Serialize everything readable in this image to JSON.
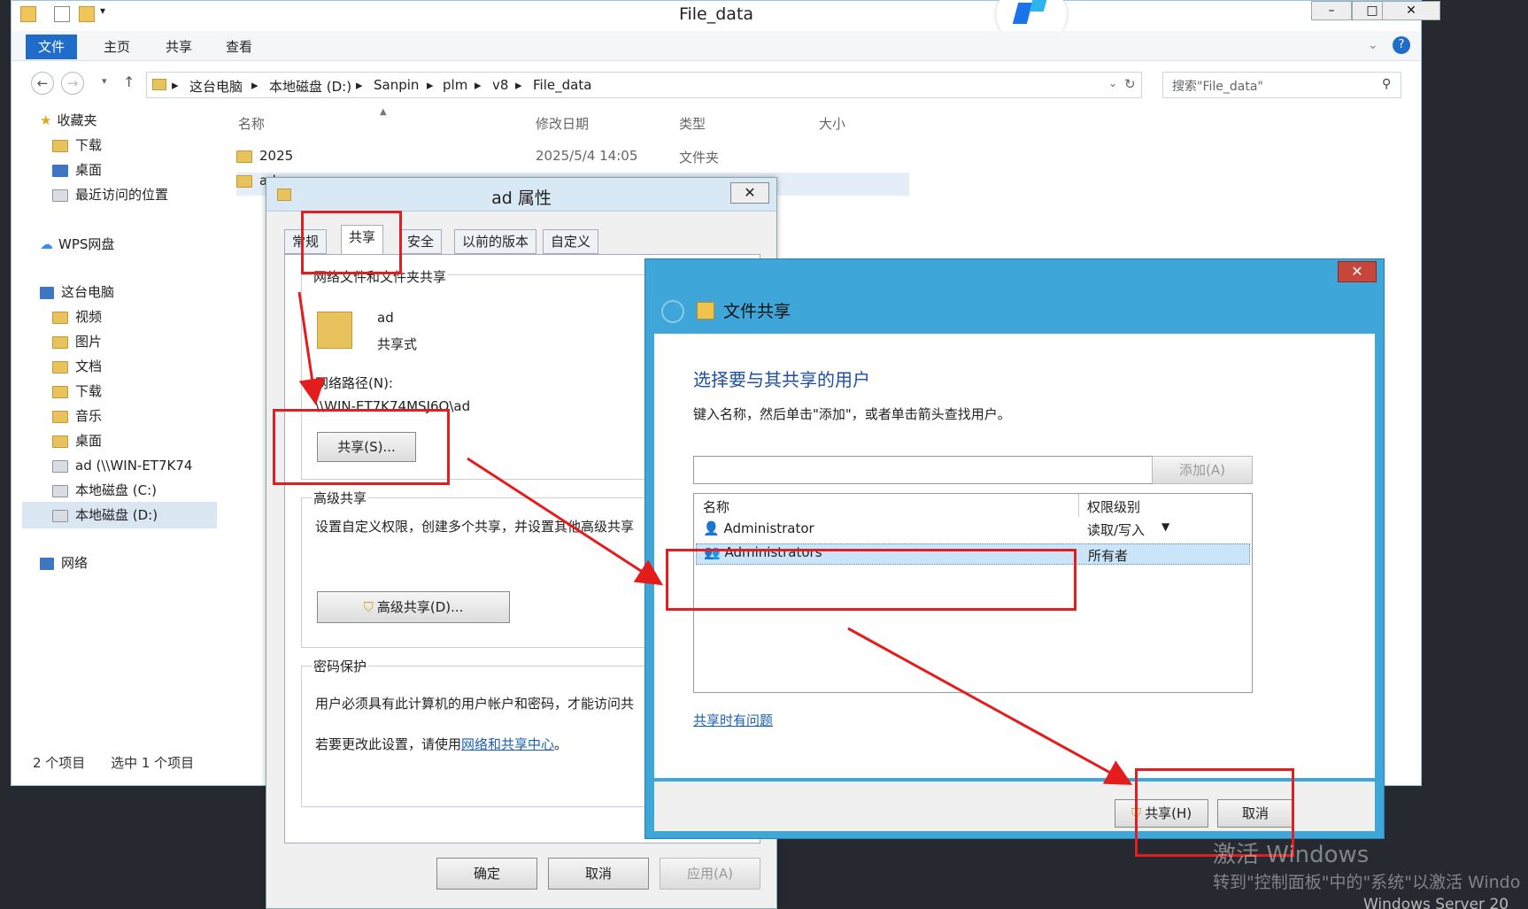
{
  "explorer": {
    "title": "File_data",
    "ribbon_tabs": [
      "文件",
      "主页",
      "共享",
      "查看"
    ],
    "breadcrumb": [
      "这台电脑",
      "本地磁盘 (D:)",
      "Sanpin",
      "plm",
      "v8",
      "File_data"
    ],
    "search_placeholder": "搜索\"File_data\"",
    "sidebar": [
      {
        "label": "收藏夹",
        "icon": "star-icon"
      },
      {
        "label": "下载",
        "icon": "folder-icon"
      },
      {
        "label": "桌面",
        "icon": "desktop-icon"
      },
      {
        "label": "最近访问的位置",
        "icon": "recent-icon"
      },
      {
        "label": "WPS网盘",
        "icon": "cloud-icon"
      },
      {
        "label": "这台电脑",
        "icon": "computer-icon"
      },
      {
        "label": "视频",
        "icon": "folder-icon"
      },
      {
        "label": "图片",
        "icon": "folder-icon"
      },
      {
        "label": "文档",
        "icon": "folder-icon"
      },
      {
        "label": "下载",
        "icon": "folder-icon"
      },
      {
        "label": "音乐",
        "icon": "folder-icon"
      },
      {
        "label": "桌面",
        "icon": "folder-icon"
      },
      {
        "label": "ad (\\\\WIN-ET7K74",
        "icon": "network-drive-icon"
      },
      {
        "label": "本地磁盘 (C:)",
        "icon": "drive-icon"
      },
      {
        "label": "本地磁盘 (D:)",
        "icon": "drive-icon"
      },
      {
        "label": "网络",
        "icon": "network-icon"
      }
    ],
    "columns": [
      "名称",
      "修改日期",
      "类型",
      "大小"
    ],
    "files": [
      {
        "name": "2025",
        "date": "2025/5/4 14:05",
        "type": "文件夹"
      },
      {
        "name": "ad",
        "date": "",
        "type": ""
      }
    ],
    "status_count": "2 个项目",
    "status_selected": "选中 1 个项目"
  },
  "props": {
    "title": "ad 属性",
    "tabs": [
      "常规",
      "共享",
      "安全",
      "以前的版本",
      "自定义"
    ],
    "group1_title": "网络文件和文件夹共享",
    "folder_name": "ad",
    "share_state": "共享式",
    "network_path_label": "网络路径(N):",
    "network_path": "\\\\WIN-ET7K74MSJ6O\\ad",
    "share_button": "共享(S)...",
    "group2_title": "高级共享",
    "group2_desc": "设置自定义权限，创建多个共享，并设置其他高级共享",
    "advanced_button": "高级共享(D)...",
    "group3_title": "密码保护",
    "group3_desc": "用户必须具有此计算机的用户帐户和密码，才能访问共",
    "group3_hint": "若要更改此设置，请使用",
    "group3_link": "网络和共享中心",
    "group3_end": "。",
    "ok": "确定",
    "cancel": "取消",
    "apply": "应用(A)"
  },
  "share_dialog": {
    "title": "文件共享",
    "heading": "选择要与其共享的用户",
    "instruction": "键入名称，然后单击\"添加\"，或者单击箭头查找用户。",
    "add_button": "添加(A)",
    "columns": [
      "名称",
      "权限级别"
    ],
    "users": [
      {
        "name": "Administrator",
        "permission": "读取/写入"
      },
      {
        "name": "Administrators",
        "permission": "所有者"
      }
    ],
    "help_link": "共享时有问题",
    "share_button": "共享(H)",
    "cancel_button": "取消"
  },
  "watermark": {
    "line1": "激活 Windows",
    "line2": "转到\"控制面板\"中的\"系统\"以激活 Windo",
    "line3": "Windows Server 20"
  },
  "colors": {
    "accent": "#1f6cc9",
    "highlight": "#e02020",
    "share_frame": "#3ea6d8"
  }
}
